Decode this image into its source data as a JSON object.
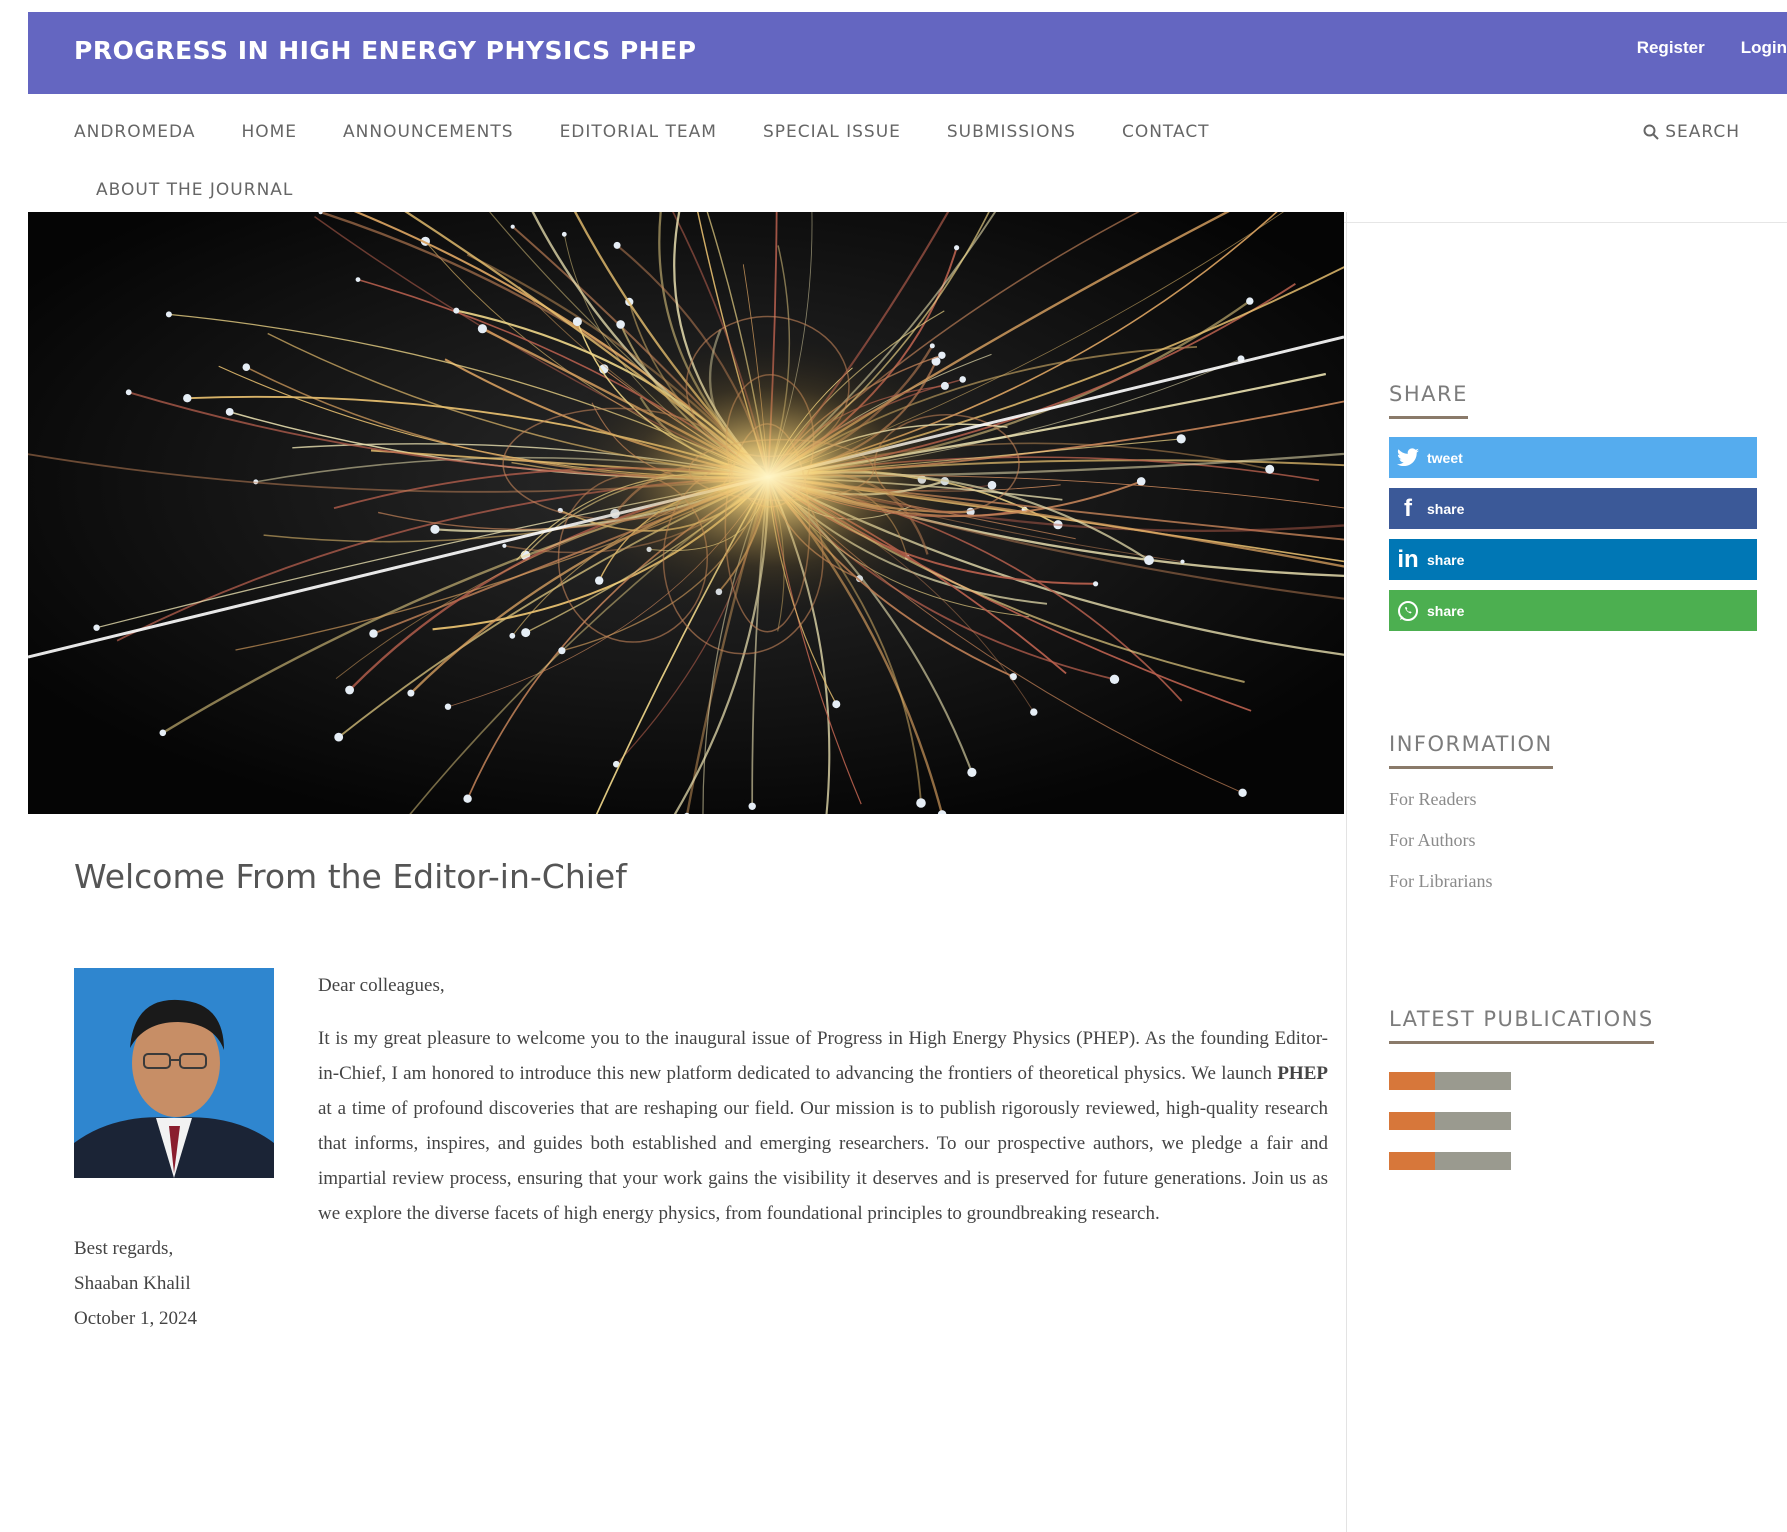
{
  "header": {
    "site_title": "PROGRESS IN HIGH ENERGY PHYSICS PHEP",
    "register": "Register",
    "login": "Login"
  },
  "nav": {
    "items": [
      "ANDROMEDA",
      "HOME",
      "ANNOUNCEMENTS",
      "EDITORIAL TEAM",
      "SPECIAL ISSUE",
      "SUBMISSIONS",
      "CONTACT"
    ],
    "about": "ABOUT THE JOURNAL",
    "search": "SEARCH"
  },
  "content": {
    "title": "Welcome From the Editor-in-Chief",
    "greeting": "Dear colleagues,",
    "body_before_bold": "It is my great pleasure to welcome you to the inaugural issue of Progress in High Energy Physics (PHEP). As the founding Editor-in-Chief, I am honored to introduce this new platform dedicated to advancing the frontiers of theoretical physics. We launch ",
    "body_bold": "PHEP",
    "body_after_bold": " at a time of profound discoveries that are reshaping our field. Our mission is to publish rigorously reviewed, high-quality research that informs, inspires, and guides both established and emerging researchers. To our prospective authors, we pledge a fair and impartial review process, ensuring that your work gains the visibility it deserves and is preserved for future generations. Join us as we explore the diverse facets of high energy physics, from foundational principles to groundbreaking research.",
    "closing": "Best regards,",
    "signature": "Shaaban Khalil",
    "date": "October 1, 2024"
  },
  "sidebar": {
    "share_title": "SHARE",
    "share_buttons": [
      {
        "label": "tweet",
        "icon": "twitter-icon",
        "color": "#55acee"
      },
      {
        "label": "share",
        "icon": "facebook-icon",
        "color": "#3b5998"
      },
      {
        "label": "share",
        "icon": "linkedin-icon",
        "color": "#0077b5"
      },
      {
        "label": "share",
        "icon": "whatsapp-icon",
        "color": "#4caf50"
      }
    ],
    "info_title": "INFORMATION",
    "info_links": [
      "For Readers",
      "For Authors",
      "For Librarians"
    ],
    "latest_title": "LATEST PUBLICATIONS"
  },
  "colors": {
    "header": "#6466c1",
    "accent_underline": "#8a7a6a"
  }
}
